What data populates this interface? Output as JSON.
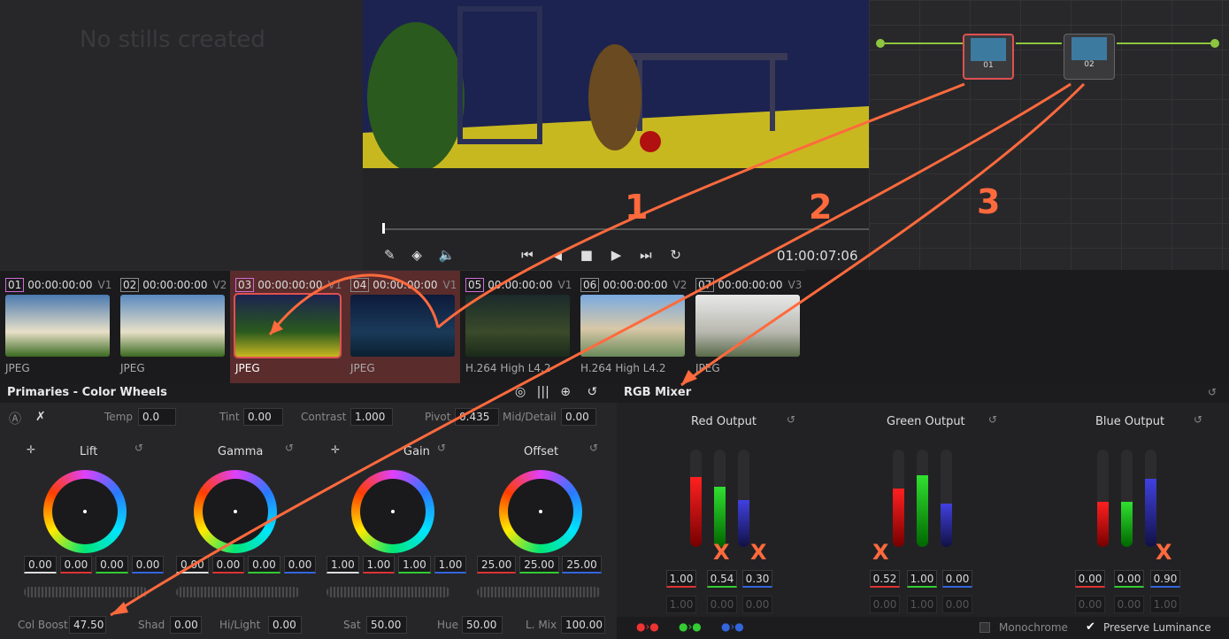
{
  "stills": {
    "empty_message": "No stills created"
  },
  "viewer": {
    "timecode": "01:00:07:06"
  },
  "clips": [
    {
      "num": "01",
      "tc": "00:00:00:00",
      "track": "V1",
      "format": "JPEG",
      "num_color": "#d06cd8"
    },
    {
      "num": "02",
      "tc": "00:00:00:00",
      "track": "V2",
      "format": "JPEG",
      "num_color": "#888888"
    },
    {
      "num": "03",
      "tc": "00:00:00:00",
      "track": "V1",
      "format": "JPEG",
      "num_color": "#d06cd8"
    },
    {
      "num": "04",
      "tc": "00:00:00:00",
      "track": "V1",
      "format": "JPEG",
      "num_color": "#888888"
    },
    {
      "num": "05",
      "tc": "00:00:00:00",
      "track": "V1",
      "format": "H.264 High L4.2",
      "num_color": "#d06cd8"
    },
    {
      "num": "06",
      "tc": "00:00:00:00",
      "track": "V2",
      "format": "H.264 High L4.2",
      "num_color": "#888888"
    },
    {
      "num": "07",
      "tc": "00:00:00:00",
      "track": "V3",
      "format": "JPEG",
      "num_color": "#888888"
    }
  ],
  "primaries": {
    "title": "Primaries - Color Wheels",
    "top": {
      "temp_label": "Temp",
      "temp": "0.0",
      "tint_label": "Tint",
      "tint": "0.00",
      "contrast_label": "Contrast",
      "contrast": "1.000",
      "pivot_label": "Pivot",
      "pivot": "0.435",
      "middetail_label": "Mid/Detail",
      "middetail": "0.00"
    },
    "wheels": [
      {
        "name": "Lift",
        "values": [
          "0.00",
          "0.00",
          "0.00",
          "0.00"
        ]
      },
      {
        "name": "Gamma",
        "values": [
          "0.00",
          "0.00",
          "0.00",
          "0.00"
        ]
      },
      {
        "name": "Gain",
        "values": [
          "1.00",
          "1.00",
          "1.00",
          "1.00"
        ]
      },
      {
        "name": "Offset",
        "values": [
          "25.00",
          "25.00",
          "25.00"
        ]
      }
    ],
    "bottom": {
      "colboost_label": "Col Boost",
      "colboost": "47.50",
      "shad_label": "Shad",
      "shad": "0.00",
      "hilight_label": "Hi/Light",
      "hilight": "0.00",
      "sat_label": "Sat",
      "sat": "50.00",
      "hue_label": "Hue",
      "hue": "50.00",
      "lmix_label": "L. Mix",
      "lmix": "100.00"
    }
  },
  "rgb": {
    "title": "RGB Mixer",
    "outputs": [
      {
        "label": "Red Output",
        "values": [
          "1.00",
          "0.54",
          "0.30"
        ],
        "dim": [
          "1.00",
          "0.00",
          "0.00"
        ],
        "levels": [
          0.72,
          0.62,
          0.48
        ]
      },
      {
        "label": "Green Output",
        "values": [
          "0.52",
          "1.00",
          "0.00"
        ],
        "dim": [
          "0.00",
          "1.00",
          "0.00"
        ],
        "levels": [
          0.6,
          0.74,
          0.45
        ]
      },
      {
        "label": "Blue Output",
        "values": [
          "0.00",
          "0.00",
          "0.90"
        ],
        "dim": [
          "0.00",
          "0.00",
          "1.00"
        ],
        "levels": [
          0.46,
          0.46,
          0.7
        ]
      }
    ],
    "monochrome": "Monochrome",
    "preserve": "Preserve Luminance"
  },
  "annotations": {
    "n1": "1",
    "n2": "2",
    "n3": "3",
    "x": "X"
  },
  "nodes": [
    {
      "label": "01"
    },
    {
      "label": "02"
    }
  ]
}
